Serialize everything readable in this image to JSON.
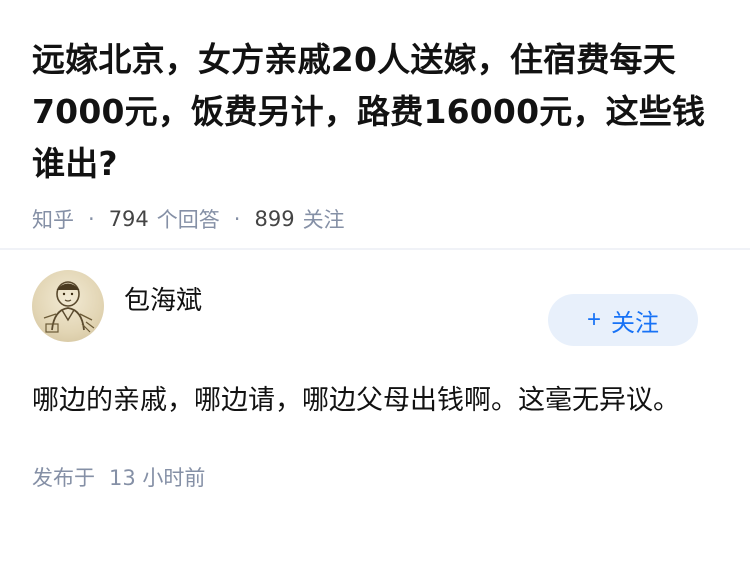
{
  "question": {
    "title": "远嫁北京，女方亲戚20人送嫁，住宿费每天7000元，饭费另计，路费16000元，这些钱谁出?",
    "source": "知乎",
    "answer_count": "794",
    "answer_label": "个回答",
    "follower_count": "899",
    "follower_label": "关注"
  },
  "answer": {
    "author_name": "包海斌",
    "follow_label": "关注",
    "content": "哪边的亲戚，哪边请，哪边父母出钱啊。这毫无异议。",
    "published_label": "发布于",
    "published_time": "13 小时前"
  }
}
